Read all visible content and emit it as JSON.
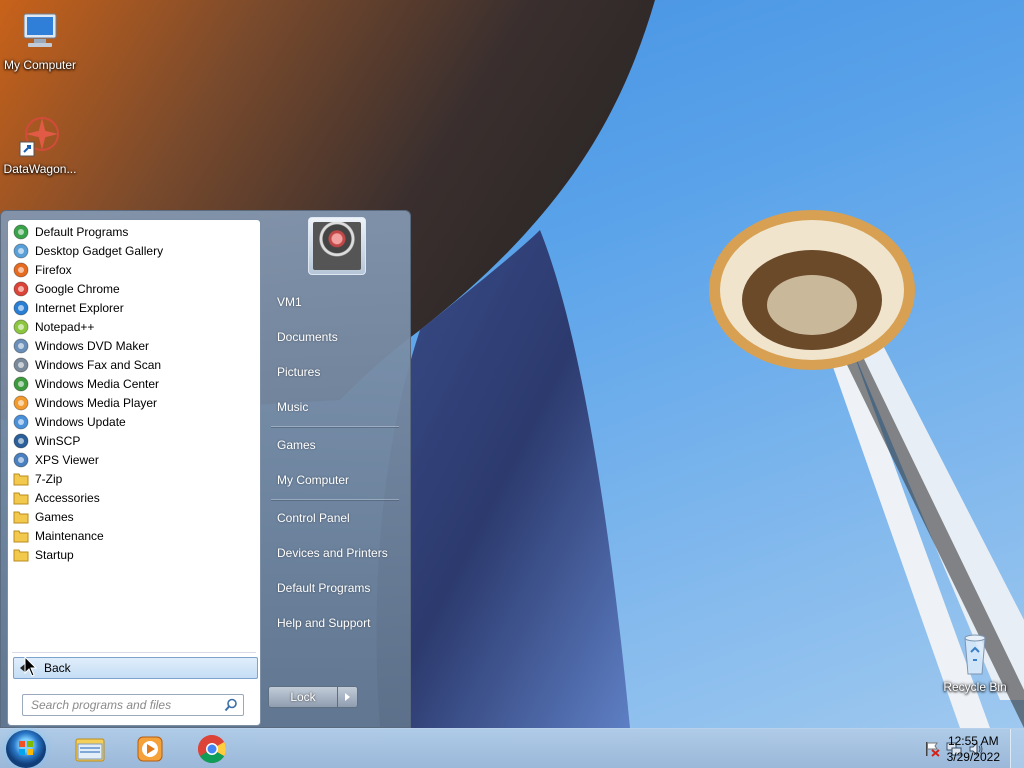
{
  "desktop": {
    "icons": [
      {
        "label": "My Computer",
        "icon": "computer-icon"
      },
      {
        "label": "DataWagon...",
        "icon": "datawagon-shortcut-icon"
      },
      {
        "label": "Recycle Bin",
        "icon": "recycle-bin-icon"
      }
    ]
  },
  "start_menu": {
    "programs": [
      {
        "label": "Default Programs",
        "icon": "default-programs-icon"
      },
      {
        "label": "Desktop Gadget Gallery",
        "icon": "gadget-gallery-icon"
      },
      {
        "label": "Firefox",
        "icon": "firefox-icon"
      },
      {
        "label": "Google Chrome",
        "icon": "chrome-icon"
      },
      {
        "label": "Internet Explorer",
        "icon": "internet-explorer-icon"
      },
      {
        "label": "Notepad++",
        "icon": "notepadpp-icon"
      },
      {
        "label": "Windows DVD Maker",
        "icon": "dvd-maker-icon"
      },
      {
        "label": "Windows Fax and Scan",
        "icon": "fax-scan-icon"
      },
      {
        "label": "Windows Media Center",
        "icon": "media-center-icon"
      },
      {
        "label": "Windows Media Player",
        "icon": "media-player-icon"
      },
      {
        "label": "Windows Update",
        "icon": "windows-update-icon"
      },
      {
        "label": "WinSCP",
        "icon": "winscp-icon"
      },
      {
        "label": "XPS Viewer",
        "icon": "xps-viewer-icon"
      },
      {
        "label": "7-Zip",
        "icon": "folder-icon"
      },
      {
        "label": "Accessories",
        "icon": "folder-icon"
      },
      {
        "label": "Games",
        "icon": "folder-icon"
      },
      {
        "label": "Maintenance",
        "icon": "folder-icon"
      },
      {
        "label": "Startup",
        "icon": "folder-icon"
      }
    ],
    "back_label": "Back",
    "search_placeholder": "Search programs and files",
    "right_items": [
      "VM1",
      "Documents",
      "Pictures",
      "Music",
      "Games",
      "My Computer",
      "Control Panel",
      "Devices and Printers",
      "Default Programs",
      "Help and Support"
    ],
    "lock_label": "Lock"
  },
  "taskbar": {
    "pinned": [
      "explorer-icon",
      "media-player-icon",
      "chrome-icon"
    ],
    "tray_icons": [
      "action-center-flag-icon",
      "network-icon",
      "volume-icon"
    ],
    "time": "12:55 AM",
    "date": "3/29/2022"
  }
}
